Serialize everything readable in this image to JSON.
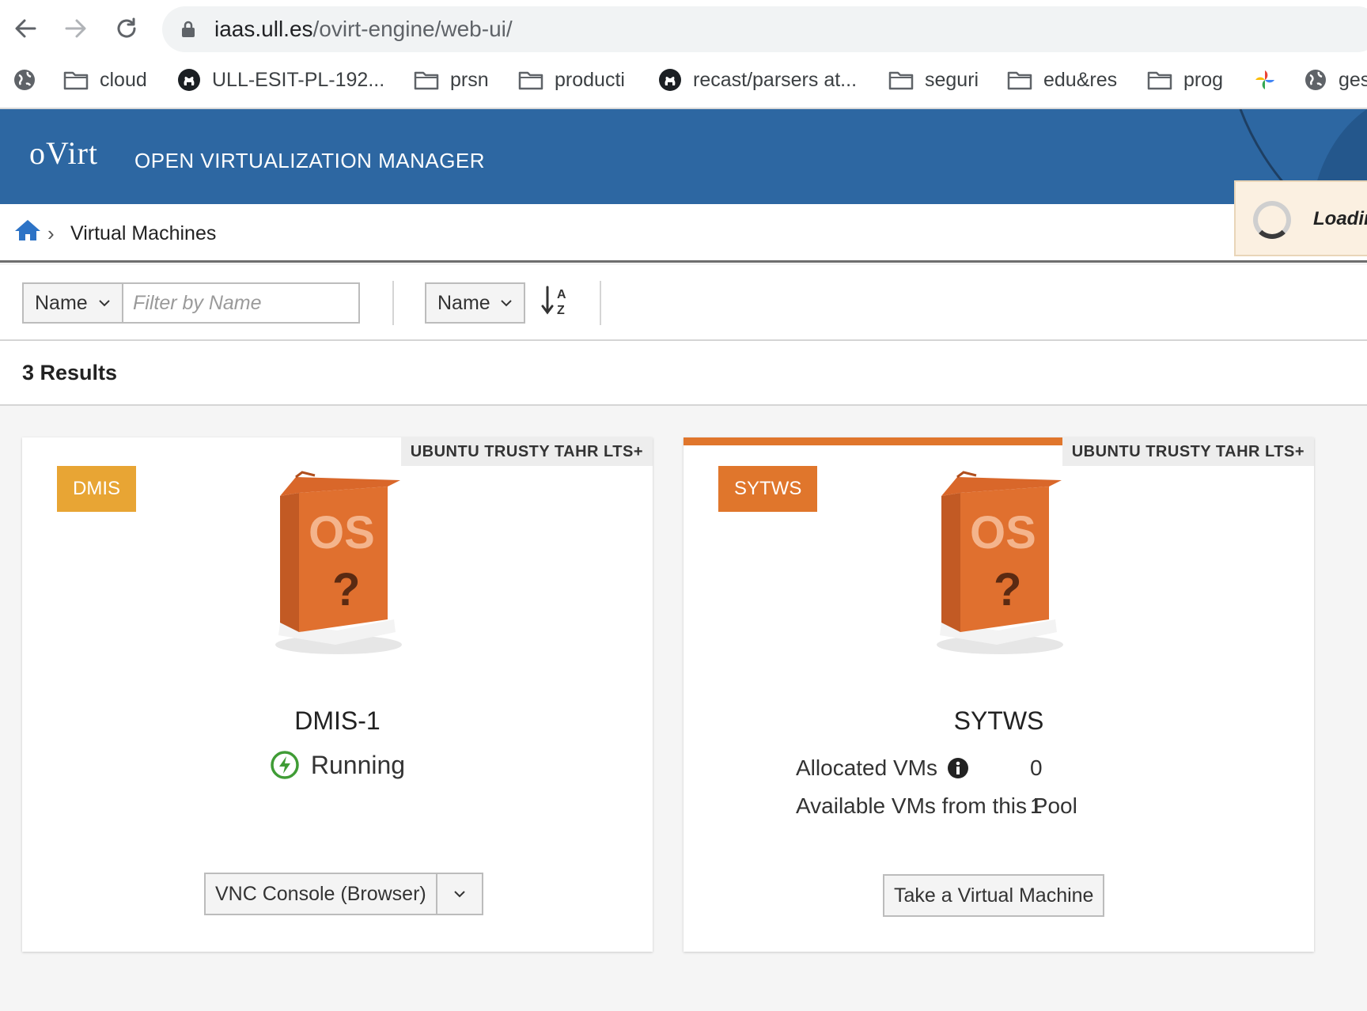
{
  "browser": {
    "url_host": "iaas.ull.es",
    "url_path": "/ovirt-engine/web-ui/",
    "bookmarks": [
      {
        "label": "",
        "icon": "globe-icon"
      },
      {
        "label": "cloud",
        "icon": "folder-icon"
      },
      {
        "label": "ULL-ESIT-PL-192...",
        "icon": "github-icon"
      },
      {
        "label": "prsn",
        "icon": "folder-icon"
      },
      {
        "label": "producti",
        "icon": "folder-icon"
      },
      {
        "label": "recast/parsers at...",
        "icon": "github-icon"
      },
      {
        "label": "seguri",
        "icon": "folder-icon"
      },
      {
        "label": "edu&res",
        "icon": "folder-icon"
      },
      {
        "label": "prog",
        "icon": "folder-icon"
      },
      {
        "label": "",
        "icon": "pinwheel-icon"
      },
      {
        "label": "ges",
        "icon": "globe-icon"
      }
    ]
  },
  "header": {
    "logo": "oVirt",
    "title": "OPEN VIRTUALIZATION MANAGER",
    "color": "#2d67a2"
  },
  "breadcrumb": {
    "current": "Virtual Machines"
  },
  "loading": {
    "text": "Loadin"
  },
  "filter": {
    "field_select": "Name",
    "placeholder": "Filter by Name",
    "sort_select": "Name"
  },
  "results": {
    "count_label": "3 Results"
  },
  "cards": [
    {
      "badge": "DMIS",
      "badge_color": "#e8a534",
      "os_tag": "UBUNTU TRUSTY TAHR LTS+",
      "name": "DMIS-1",
      "status": "Running",
      "status_color": "#3f9c35",
      "action": "VNC Console (Browser)"
    },
    {
      "badge": "SYTWS",
      "badge_color": "#e0762c",
      "os_tag": "UBUNTU TRUSTY TAHR LTS+",
      "name": "SYTWS",
      "rows": [
        {
          "label": "Allocated VMs",
          "value": "0"
        },
        {
          "label": "Available VMs from this Pool",
          "value": "1"
        }
      ],
      "action": "Take a Virtual Machine"
    }
  ]
}
